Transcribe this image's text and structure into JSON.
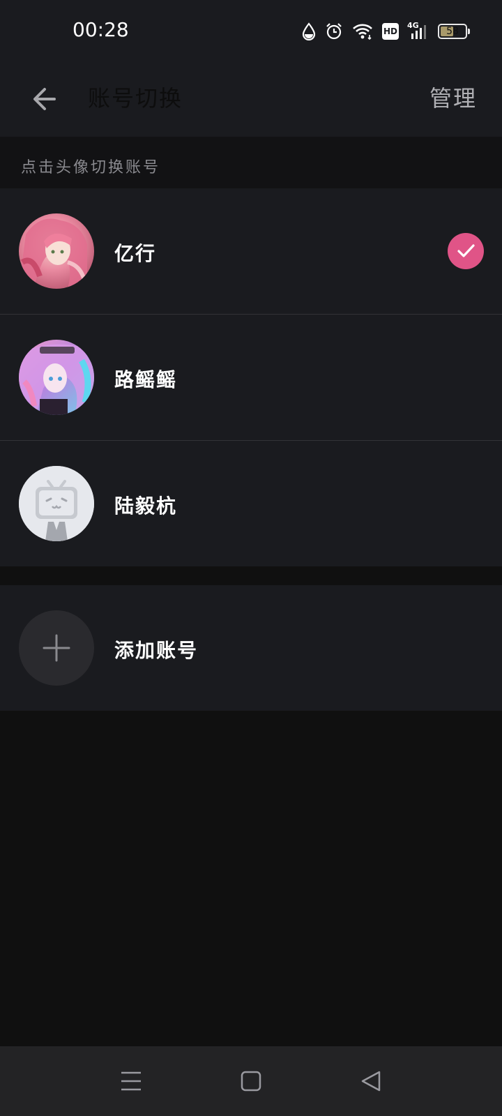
{
  "status_bar": {
    "time": "00:28",
    "battery_level": 58,
    "battery_label": "58",
    "hd_label": "HD",
    "network_label": "4G",
    "icons": [
      "droplet-icon",
      "alarm-icon",
      "wifi-icon",
      "hd-icon",
      "signal-icon",
      "battery-icon"
    ]
  },
  "app_bar": {
    "title": "账号切换",
    "manage_label": "管理",
    "back_icon": "arrow-left-icon"
  },
  "hint": "点击头像切换账号",
  "accounts": [
    {
      "name": "亿行",
      "selected": true,
      "avatar": "anime-avatar-pink"
    },
    {
      "name": "路鳐鳐",
      "selected": false,
      "avatar": "anime-avatar-purple"
    },
    {
      "name": "陆毅杭",
      "selected": false,
      "avatar": "default-tv-avatar"
    }
  ],
  "add_account": {
    "label": "添加账号",
    "icon": "plus-icon"
  },
  "colors": {
    "accent": "#e05487",
    "background": "#101010",
    "surface": "#1a1b1f"
  },
  "nav_bar": {
    "icons": [
      "menu-icon",
      "home-square-icon",
      "back-triangle-icon"
    ]
  }
}
